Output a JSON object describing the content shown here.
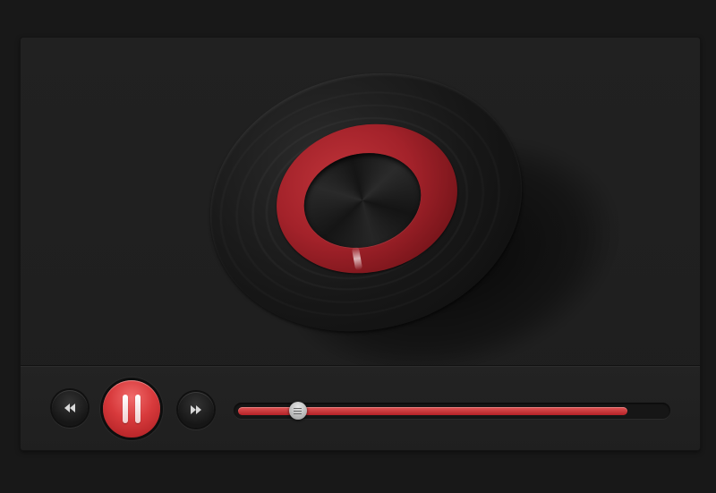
{
  "player": {
    "progress_fraction": 0.14,
    "buffered_fraction": 0.91,
    "is_playing": true,
    "accent_color": "#d83a3c"
  },
  "icons": {
    "rewind": "rewind-icon",
    "play_pause": "pause-icon",
    "forward": "fast-forward-icon",
    "seek_thumb": "grip-icon",
    "disc": "vinyl-record-icon"
  }
}
